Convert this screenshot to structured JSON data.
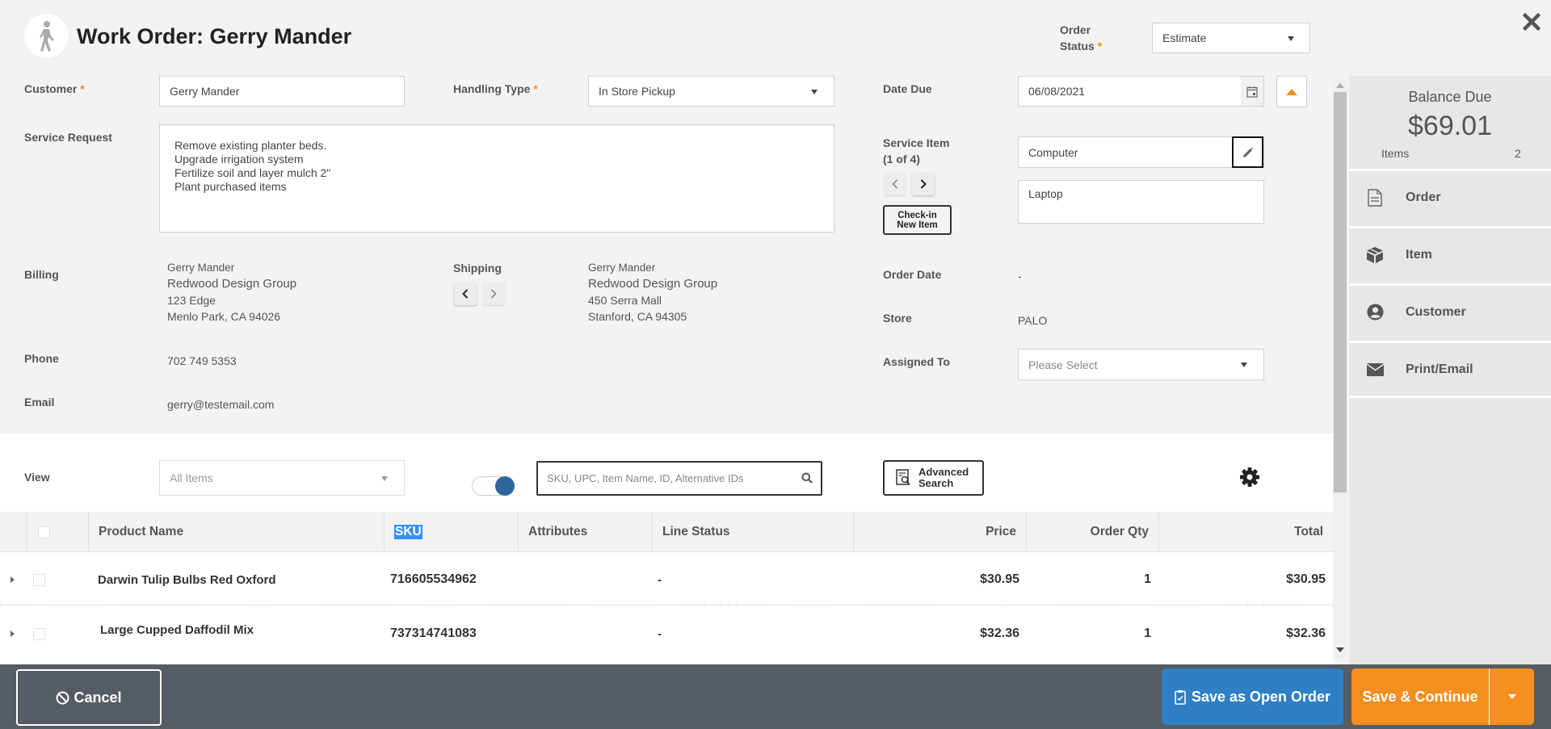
{
  "header": {
    "title": "Work Order: Gerry Mander",
    "order_status_label_line1": "Order",
    "order_status_label_line2": "Status",
    "required_mark": "*",
    "order_status_value": "Estimate",
    "close_icon": "close-icon"
  },
  "form": {
    "customer_label": "Customer",
    "customer_value": "Gerry Mander",
    "handling_type_label": "Handling Type",
    "handling_type_value": "In Store Pickup",
    "date_due_label": "Date Due",
    "date_due_value": "06/08/2021",
    "service_request_label": "Service Request",
    "service_request_value": "Remove existing planter beds.\nUpgrade irrigation system\nFertilize soil and layer mulch 2\"\nPlant purchased items",
    "service_item_label": "Service Item",
    "service_item_counter": "(1 of 4)",
    "service_item_name": "Computer",
    "service_item_desc": "Laptop",
    "checkin_line1": "Check-in",
    "checkin_line2": "New Item",
    "billing_label": "Billing",
    "billing": {
      "name": "Gerry Mander",
      "company": "Redwood Design Group",
      "street": "123 Edge",
      "city": "Menlo Park, CA 94026"
    },
    "shipping_label": "Shipping",
    "shipping": {
      "name": "Gerry Mander",
      "company": "Redwood Design Group",
      "street": "450 Serra Mall",
      "city": "Stanford, CA 94305"
    },
    "order_date_label": "Order Date",
    "order_date_value": "-",
    "store_label": "Store",
    "store_value": "PALO",
    "assigned_to_label": "Assigned To",
    "assigned_to_placeholder": "Please Select",
    "phone_label": "Phone",
    "phone_value": "702 749 5353",
    "email_label": "Email",
    "email_value": "gerry@testemail.com"
  },
  "summary": {
    "balance_label": "Balance Due",
    "balance_value": "$69.01",
    "items_label": "Items",
    "items_count": "2",
    "nav": [
      {
        "label": "Order",
        "icon": "document-icon"
      },
      {
        "label": "Item",
        "icon": "box-icon"
      },
      {
        "label": "Customer",
        "icon": "user-circle-icon"
      },
      {
        "label": "Print/Email",
        "icon": "envelope-icon"
      }
    ]
  },
  "items_toolbar": {
    "view_label": "View",
    "view_value": "All Items",
    "toggle_on": true,
    "search_placeholder": "SKU, UPC, Item Name, ID, Alternative IDs",
    "search_value": "",
    "advanced_line1": "Advanced",
    "advanced_line2": "Search"
  },
  "table": {
    "columns": [
      "Product Name",
      "SKU",
      "Attributes",
      "Line Status",
      "Price",
      "Order Qty",
      "Total"
    ],
    "rows": [
      {
        "product": "Darwin Tulip Bulbs Red Oxford",
        "sku": "716605534962",
        "attributes": "",
        "line_status": "-",
        "price": "$30.95",
        "qty": "1",
        "total": "$30.95"
      },
      {
        "product": "Large Cupped Daffodil Mix",
        "sku": "737314741083",
        "attributes": "",
        "line_status": "-",
        "price": "$32.36",
        "qty": "1",
        "total": "$32.36"
      }
    ]
  },
  "footer": {
    "cancel_label": "Cancel",
    "open_order_label": "Save as Open Order",
    "continue_label": "Save & Continue"
  },
  "colors": {
    "accent_orange": "#f58f1f",
    "primary_blue": "#2e7fc4",
    "footer_bg": "#555c63",
    "toggle_blue": "#2e6699"
  }
}
